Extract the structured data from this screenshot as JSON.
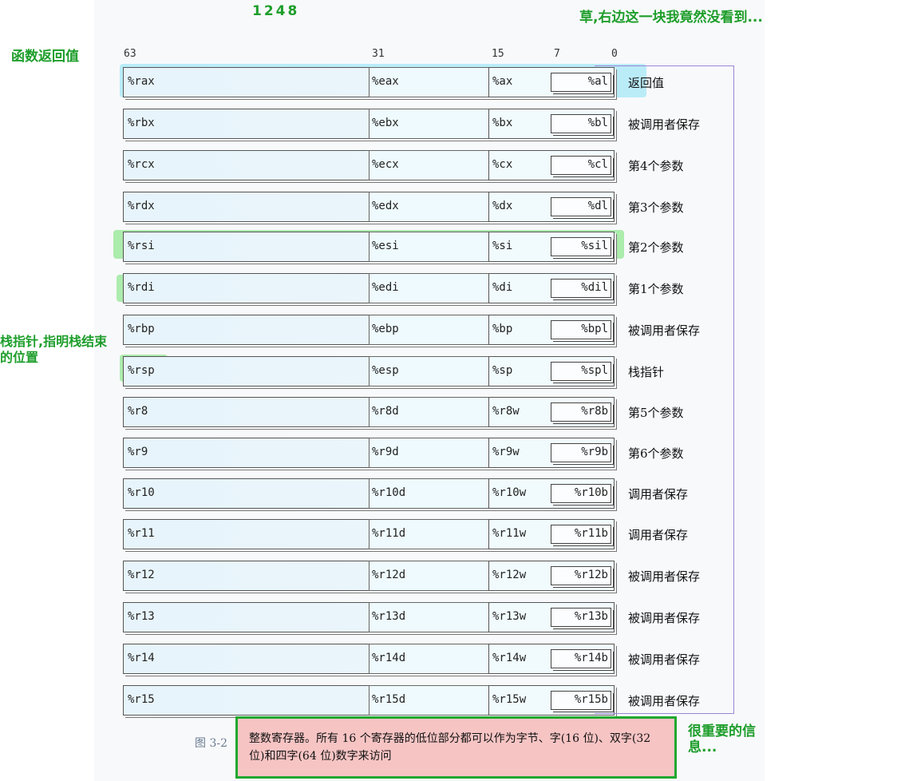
{
  "annotations": {
    "top_numbers": "1248",
    "return_fn": "函数返回值",
    "stack_pointer": "栈指针,指明栈结束的位置",
    "right_block": "草,右边这一块我竟然没看到...",
    "important": "很重要的信息..."
  },
  "bit_positions": [
    "63",
    "31",
    "15",
    "7",
    "0"
  ],
  "registers": [
    {
      "r64": "%rax",
      "r32": "%eax",
      "r16": "%ax",
      "r8": "%al",
      "role": "返回值"
    },
    {
      "r64": "%rbx",
      "r32": "%ebx",
      "r16": "%bx",
      "r8": "%bl",
      "role": "被调用者保存"
    },
    {
      "r64": "%rcx",
      "r32": "%ecx",
      "r16": "%cx",
      "r8": "%cl",
      "role": "第4个参数"
    },
    {
      "r64": "%rdx",
      "r32": "%edx",
      "r16": "%dx",
      "r8": "%dl",
      "role": "第3个参数"
    },
    {
      "r64": "%rsi",
      "r32": "%esi",
      "r16": "%si",
      "r8": "%sil",
      "role": "第2个参数"
    },
    {
      "r64": "%rdi",
      "r32": "%edi",
      "r16": "%di",
      "r8": "%dil",
      "role": "第1个参数"
    },
    {
      "r64": "%rbp",
      "r32": "%ebp",
      "r16": "%bp",
      "r8": "%bpl",
      "role": "被调用者保存"
    },
    {
      "r64": "%rsp",
      "r32": "%esp",
      "r16": "%sp",
      "r8": "%spl",
      "role": "栈指针"
    },
    {
      "r64": "%r8",
      "r32": "%r8d",
      "r16": "%r8w",
      "r8": "%r8b",
      "role": "第5个参数"
    },
    {
      "r64": "%r9",
      "r32": "%r9d",
      "r16": "%r9w",
      "r8": "%r9b",
      "role": "第6个参数"
    },
    {
      "r64": "%r10",
      "r32": "%r10d",
      "r16": "%r10w",
      "r8": "%r10b",
      "role": "调用者保存"
    },
    {
      "r64": "%r11",
      "r32": "%r11d",
      "r16": "%r11w",
      "r8": "%r11b",
      "role": "调用者保存"
    },
    {
      "r64": "%r12",
      "r32": "%r12d",
      "r16": "%r12w",
      "r8": "%r12b",
      "role": "被调用者保存"
    },
    {
      "r64": "%r13",
      "r32": "%r13d",
      "r16": "%r13w",
      "r8": "%r13b",
      "role": "被调用者保存"
    },
    {
      "r64": "%r14",
      "r32": "%r14d",
      "r16": "%r14w",
      "r8": "%r14b",
      "role": "被调用者保存"
    },
    {
      "r64": "%r15",
      "r32": "%r15d",
      "r16": "%r15w",
      "r8": "%r15b",
      "role": "被调用者保存"
    }
  ],
  "caption": {
    "figure_label": "图 3-2",
    "text": "整数寄存器。所有 16 个寄存器的低位部分都可以作为字节、字(16 位)、双字(32 位)和四字(64 位)数字来访问"
  },
  "colors": {
    "annotation": "#1e9e2b",
    "highlight_cyan": "#87e1f5",
    "highlight_green": "#6ee16e",
    "caption_bg": "#f7c4c4",
    "caption_border": "#1fa82f",
    "purple_rule": "#8a6cc8"
  }
}
